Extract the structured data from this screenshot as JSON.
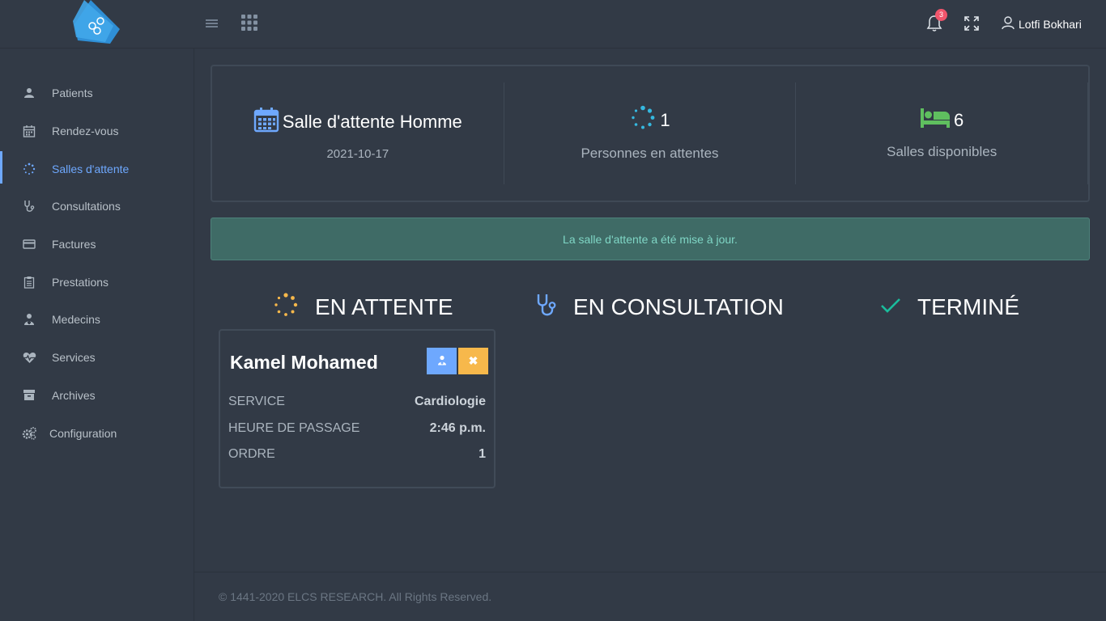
{
  "header": {
    "logo_icon": "brain-network-logo",
    "menu_icon": "hamburger-icon",
    "apps_icon": "grid-apps-icon",
    "notifications": {
      "icon": "bell-icon",
      "count": "3"
    },
    "fullscreen_icon": "expand-icon",
    "user": {
      "icon": "user-icon",
      "name": "Lotfi Bokhari"
    }
  },
  "sidebar": {
    "items": [
      {
        "label": "Patients",
        "icon": "user-icon"
      },
      {
        "label": "Rendez-vous",
        "icon": "calendar-icon"
      },
      {
        "label": "Salles d'attente",
        "icon": "spinner-icon",
        "active": true
      },
      {
        "label": "Consultations",
        "icon": "stethoscope-icon"
      },
      {
        "label": "Factures",
        "icon": "credit-card-icon"
      },
      {
        "label": "Prestations",
        "icon": "clipboard-icon"
      },
      {
        "label": "Medecins",
        "icon": "doctor-icon"
      },
      {
        "label": "Services",
        "icon": "heartbeat-icon"
      },
      {
        "label": "Archives",
        "icon": "archive-icon"
      },
      {
        "label": "Configuration",
        "icon": "gears-icon"
      }
    ]
  },
  "stats": {
    "room": {
      "title": "Salle d'attente Homme",
      "date": "2021-10-17",
      "icon": "calendar-icon"
    },
    "waiting": {
      "count": "1",
      "label": "Personnes en attentes",
      "icon": "spinner-icon"
    },
    "rooms_available": {
      "count": "6",
      "label": "Salles disponibles",
      "icon": "bed-icon"
    }
  },
  "alert": {
    "message": "La salle d'attente a été mise à jour."
  },
  "columns": [
    {
      "title": "EN ATTENTE",
      "icon": "spinner-icon"
    },
    {
      "title": "EN CONSULTATION",
      "icon": "stethoscope-icon"
    },
    {
      "title": "TERMINÉ",
      "icon": "check-icon"
    }
  ],
  "patient_card": {
    "name": "Kamel Mohamed",
    "rows": [
      {
        "key": "SERVICE",
        "value": "Cardiologie"
      },
      {
        "key": "HEURE DE PASSAGE",
        "value": "2:46 p.m."
      },
      {
        "key": "ORDRE",
        "value": "1"
      }
    ],
    "buttons": {
      "consult_icon": "doctor-icon",
      "remove_icon": "close-icon",
      "remove_label": "✖"
    }
  },
  "footer": {
    "text": "© 1441-2020 ELCS RESEARCH. All Rights Reserved."
  },
  "colors": {
    "accent": "#6ea8fe",
    "warning": "#f7b84b",
    "success": "#1abc9c",
    "bed": "#5fbf5f",
    "danger": "#f1556c"
  }
}
